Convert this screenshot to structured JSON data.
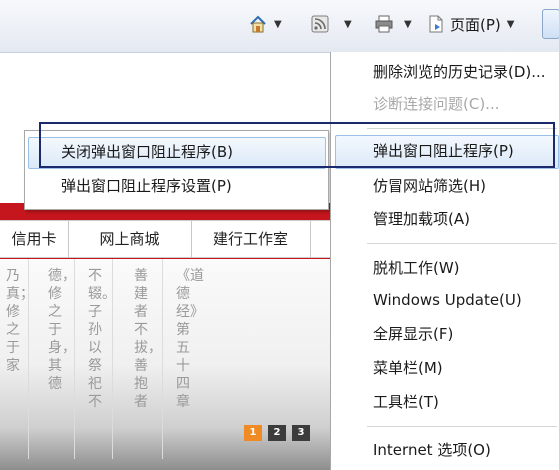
{
  "toolbar": {
    "home_icon": "home-icon",
    "feeds_icon": "feeds-icon",
    "print_icon": "print-icon",
    "page_icon": "page-icon",
    "page_label": "页面(P)",
    "dropdown_glyph": "▼"
  },
  "page": {
    "tabs": [
      "信用卡",
      "网上商城",
      "建行工作室"
    ],
    "poem_columns": [
      "乃真；修之于家",
      "德，修之于身，其德",
      "不辍。子孙以祭祀不",
      "善建者不拔，善抱者",
      "《道德经》第五十四章"
    ],
    "pager": [
      "1",
      "2",
      "3"
    ],
    "pager_active_color": "#f08a24",
    "pager_color": "#3c3c3c"
  },
  "popup_submenu": {
    "items": [
      {
        "label": "关闭弹出窗口阻止程序(B)",
        "highlighted": true
      },
      {
        "label": "弹出窗口阻止程序设置(P)",
        "highlighted": false
      }
    ]
  },
  "tools_menu": {
    "items": [
      {
        "label": "删除浏览的历史记录(D)...",
        "disabled": false
      },
      {
        "label": "诊断连接问题(C)...",
        "disabled": true
      },
      {
        "label": "弹出窗口阻止程序(P)",
        "disabled": false,
        "highlighted": true
      },
      {
        "label": "仿冒网站筛选(H)",
        "disabled": false
      },
      {
        "label": "管理加载项(A)",
        "disabled": false
      },
      {
        "label": "脱机工作(W)",
        "disabled": false
      },
      {
        "label": "Windows Update(U)",
        "disabled": false
      },
      {
        "label": "全屏显示(F)",
        "disabled": false
      },
      {
        "label": "菜单栏(M)",
        "disabled": false
      },
      {
        "label": "工具栏(T)",
        "disabled": false
      },
      {
        "label": "Internet 选项(O)",
        "disabled": false
      }
    ]
  },
  "colors": {
    "brand_red": "#c4161c",
    "highlight_border": "#9ac0e6",
    "annotation_border": "#1a2a6c"
  }
}
